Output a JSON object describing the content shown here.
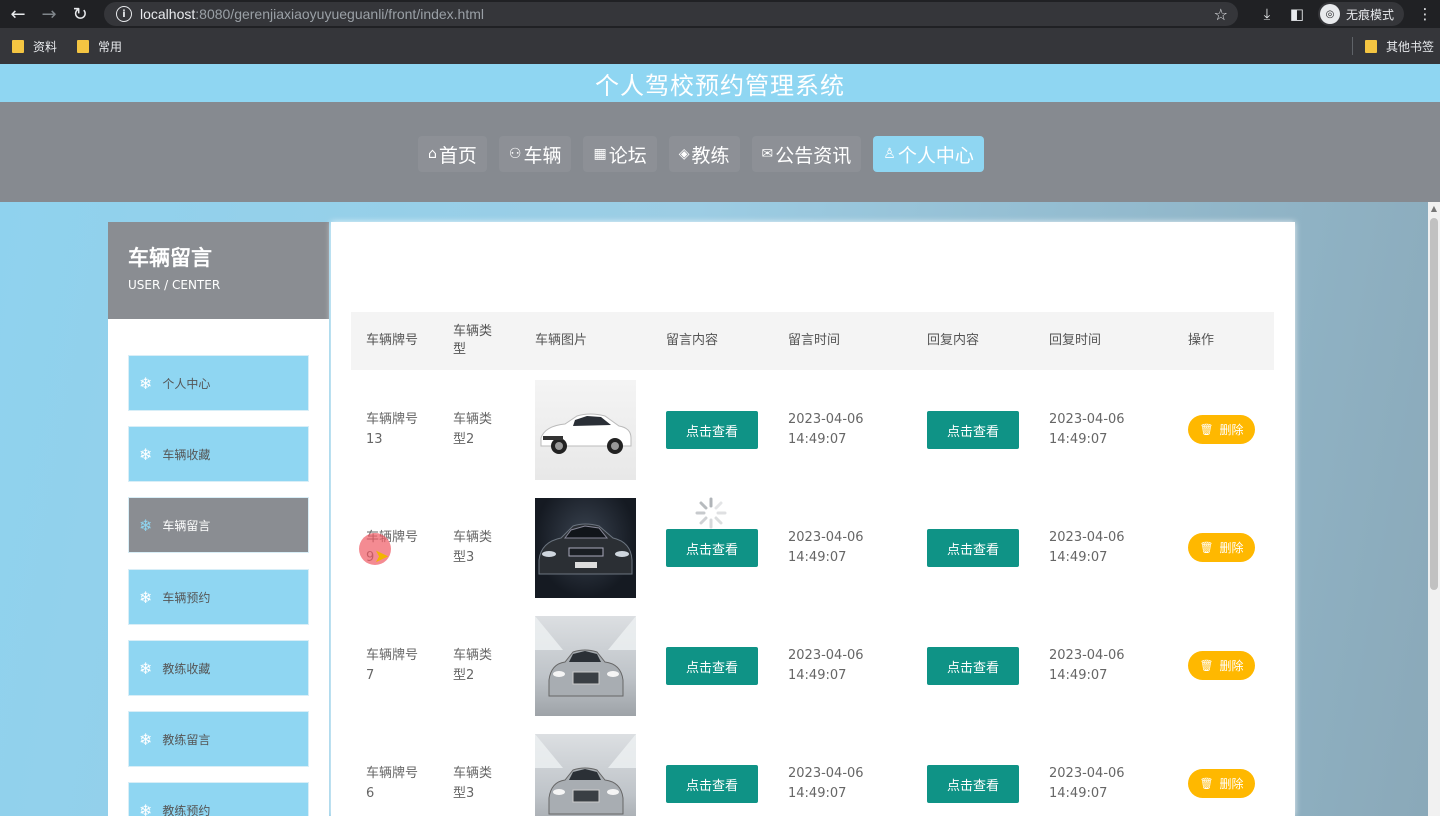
{
  "browser": {
    "url_host": "localhost",
    "url_rest": ":8080/gerenjiaxiaoyuyueguanli/front/index.html",
    "incognito_label": "无痕模式",
    "bookmarks": [
      "资料",
      "常用"
    ],
    "other_bookmarks": "其他书签"
  },
  "site": {
    "title": "个人驾校预约管理系统",
    "menu": [
      {
        "icon": "home-icon",
        "glyph": "⌂",
        "label": "首页"
      },
      {
        "icon": "car-icon",
        "glyph": "⚇",
        "label": "车辆"
      },
      {
        "icon": "forum-icon",
        "glyph": "▦",
        "label": "论坛"
      },
      {
        "icon": "coach-icon",
        "glyph": "◈",
        "label": "教练"
      },
      {
        "icon": "mail-icon",
        "glyph": "✉",
        "label": "公告资讯"
      },
      {
        "icon": "user-icon",
        "glyph": "♙",
        "label": "个人中心"
      }
    ]
  },
  "sidebar": {
    "title": "车辆留言",
    "subtitle": "USER / CENTER",
    "items": [
      "个人中心",
      "车辆收藏",
      "车辆留言",
      "车辆预约",
      "教练收藏",
      "教练留言",
      "教练预约"
    ],
    "active_index": 2
  },
  "table": {
    "headers": [
      "车辆牌号",
      "车辆类型",
      "车辆图片",
      "留言内容",
      "留言时间",
      "回复内容",
      "回复时间",
      "操作"
    ],
    "view_label": "点击查看",
    "delete_label": "删除",
    "rows": [
      {
        "plate": "车辆牌号13",
        "type": "车辆类型2",
        "image": "white-coupe",
        "msg_time": "2023-04-06 14:49:07",
        "reply_time": "2023-04-06 14:49:07"
      },
      {
        "plate": "车辆牌号9",
        "type": "车辆类型3",
        "image": "black-sedan",
        "msg_time": "2023-04-06 14:49:07",
        "reply_time": "2023-04-06 14:49:07"
      },
      {
        "plate": "车辆牌号7",
        "type": "车辆类型2",
        "image": "silver-car",
        "msg_time": "2023-04-06 14:49:07",
        "reply_time": "2023-04-06 14:49:07"
      },
      {
        "plate": "车辆牌号6",
        "type": "车辆类型3",
        "image": "silver-car",
        "msg_time": "2023-04-06 14:49:07",
        "reply_time": "2023-04-06 14:49:07"
      }
    ]
  }
}
